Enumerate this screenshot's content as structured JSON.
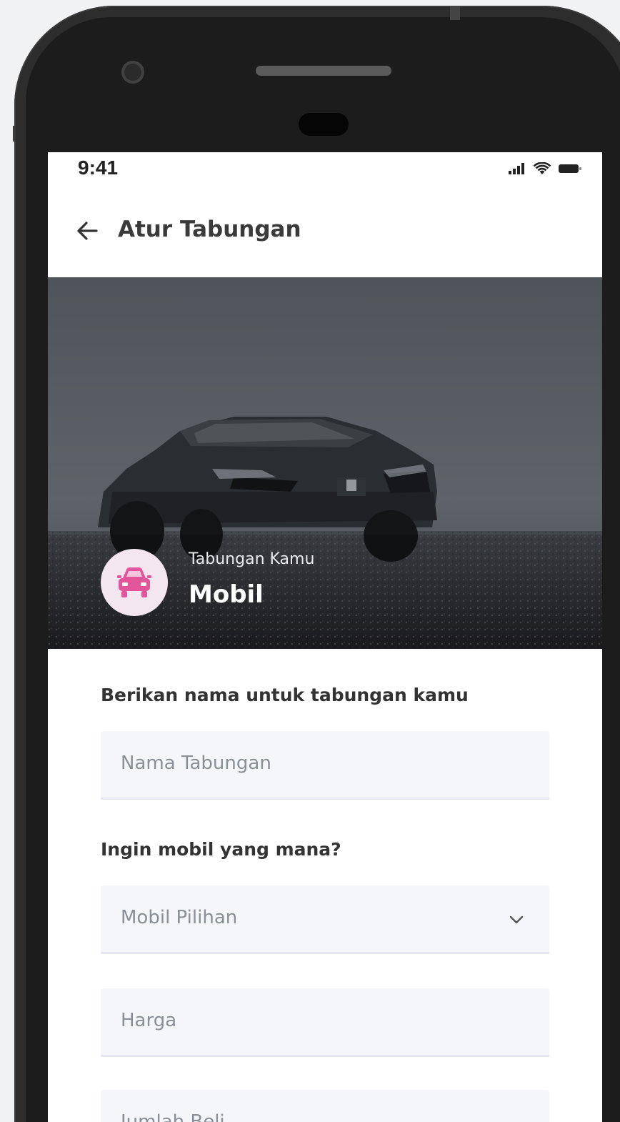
{
  "status_bar": {
    "time": "9:41",
    "icons": [
      "signal-icon",
      "wifi-icon",
      "battery-icon"
    ]
  },
  "header": {
    "back_icon": "arrow-left-icon",
    "title": "Atur Tabungan"
  },
  "hero": {
    "subtitle": "Tabungan Kamu",
    "title": "Mobil",
    "avatar_icon": "car-icon",
    "avatar_icon_color": "#e2559b"
  },
  "form": {
    "name_label": "Berikan nama untuk tabungan kamu",
    "name_placeholder": "Nama Tabungan",
    "car_label": "Ingin mobil yang mana?",
    "car_select": "Mobil Pilihan",
    "price_placeholder": "Harga",
    "quantity_placeholder": "Jumlah Beli"
  }
}
